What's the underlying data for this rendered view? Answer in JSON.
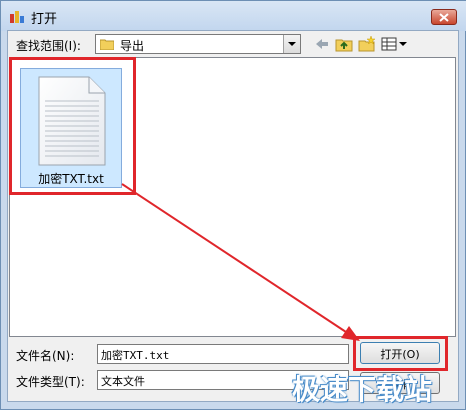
{
  "window": {
    "title": "打开"
  },
  "toolbar": {
    "look_in_label": "查找范围(I):",
    "look_in_value": "导出"
  },
  "files": [
    {
      "name": "加密TXT.txt"
    }
  ],
  "form": {
    "filename_label": "文件名(N):",
    "filename_value": "加密TXT.txt",
    "filetype_label": "文件类型(T):",
    "filetype_value": "文本文件",
    "open_label": "打开(O)",
    "cancel_label": "取消"
  },
  "watermark": "极速下载站",
  "colors": {
    "highlight": "#e0262b",
    "selection": "#cde8ff"
  },
  "icons": [
    "app-icon",
    "close-icon",
    "folder-icon",
    "back-icon",
    "up-folder-icon",
    "new-folder-icon",
    "view-menu-icon",
    "text-file-icon"
  ]
}
